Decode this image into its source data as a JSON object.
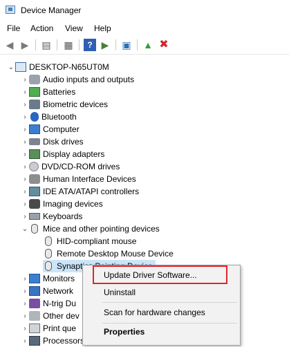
{
  "window": {
    "title": "Device Manager"
  },
  "menu": [
    "File",
    "Action",
    "View",
    "Help"
  ],
  "toolbar": {
    "icons": [
      "back-icon",
      "forward-icon",
      "show-hide-tree-icon",
      "properties-icon",
      "help-icon",
      "run-icon",
      "scan-hardware-icon",
      "update-driver-icon",
      "uninstall-icon"
    ],
    "colors": {
      "help": "#2e5fb3",
      "uninstall": "#d8232a",
      "update": "#2f9e3a"
    }
  },
  "tree": {
    "root": "DESKTOP-N65UT0M",
    "categories": [
      {
        "label": "Audio inputs and outputs",
        "icon": "speaker-icon"
      },
      {
        "label": "Batteries",
        "icon": "battery-icon"
      },
      {
        "label": "Biometric devices",
        "icon": "biometric-icon"
      },
      {
        "label": "Bluetooth",
        "icon": "bluetooth-icon"
      },
      {
        "label": "Computer",
        "icon": "computer-icon"
      },
      {
        "label": "Disk drives",
        "icon": "disk-drive-icon"
      },
      {
        "label": "Display adapters",
        "icon": "display-adapter-icon"
      },
      {
        "label": "DVD/CD-ROM drives",
        "icon": "dvd-icon"
      },
      {
        "label": "Human Interface Devices",
        "icon": "hid-icon"
      },
      {
        "label": "IDE ATA/ATAPI controllers",
        "icon": "ide-controller-icon"
      },
      {
        "label": "Imaging devices",
        "icon": "camera-icon"
      },
      {
        "label": "Keyboards",
        "icon": "keyboard-icon"
      },
      {
        "label": "Mice and other pointing devices",
        "icon": "mouse-icon",
        "expanded": true
      }
    ],
    "mice_children": [
      {
        "label": "HID-compliant mouse"
      },
      {
        "label": "Remote Desktop Mouse Device"
      },
      {
        "label": "Synaptics Pointing Device",
        "selected": true
      }
    ],
    "after": [
      {
        "label": "Monitors",
        "icon": "monitor-icon"
      },
      {
        "label": "Network",
        "icon": "network-icon"
      },
      {
        "label": "N-trig Du",
        "icon": "ntrig-icon"
      },
      {
        "label": "Other dev",
        "icon": "other-device-icon"
      },
      {
        "label": "Print que",
        "icon": "printer-icon"
      },
      {
        "label": "Processors",
        "icon": "processor-icon"
      }
    ]
  },
  "context_menu": {
    "update": "Update Driver Software...",
    "uninstall": "Uninstall",
    "scan": "Scan for hardware changes",
    "properties": "Properties",
    "highlight_color": "#e0242b"
  }
}
